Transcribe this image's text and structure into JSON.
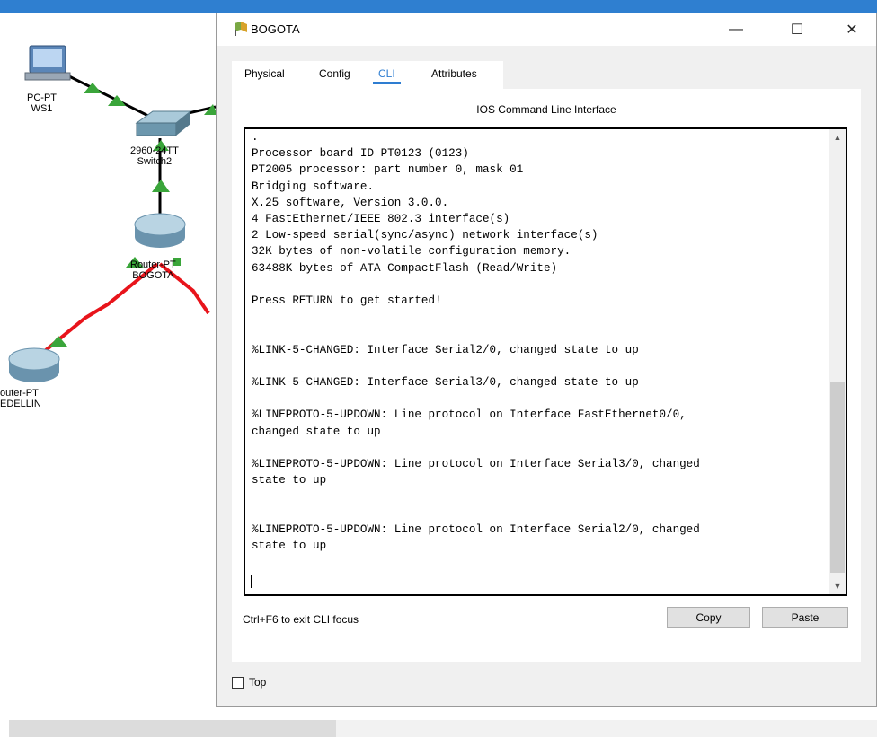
{
  "window": {
    "title": "BOGOTA",
    "minimize_glyph": "—",
    "maximize_glyph": "☐",
    "close_glyph": "✕"
  },
  "tabs": [
    "Physical",
    "Config",
    "CLI",
    "Attributes"
  ],
  "active_tab": "CLI",
  "panel_title": "IOS Command Line Interface",
  "cli_output": ".\nProcessor board ID PT0123 (0123)\nPT2005 processor: part number 0, mask 01\nBridging software.\nX.25 software, Version 3.0.0.\n4 FastEthernet/IEEE 802.3 interface(s)\n2 Low-speed serial(sync/async) network interface(s)\n32K bytes of non-volatile configuration memory.\n63488K bytes of ATA CompactFlash (Read/Write)\n\nPress RETURN to get started!\n\n\n%LINK-5-CHANGED: Interface Serial2/0, changed state to up\n\n%LINK-5-CHANGED: Interface Serial3/0, changed state to up\n\n%LINEPROTO-5-UPDOWN: Line protocol on Interface FastEthernet0/0,\nchanged state to up\n\n%LINEPROTO-5-UPDOWN: Line protocol on Interface Serial3/0, changed\nstate to up\n\n\n%LINEPROTO-5-UPDOWN: Line protocol on Interface Serial2/0, changed\nstate to up",
  "cli_hint": "Ctrl+F6 to exit CLI focus",
  "buttons": {
    "copy": "Copy",
    "paste": "Paste"
  },
  "top_checkbox": {
    "label": "Top",
    "checked": false
  },
  "topology": {
    "devices": [
      {
        "label_line1": "PC-PT",
        "label_line2": "WS1",
        "icon": "pc-icon"
      },
      {
        "label_line1": "2960-24TT",
        "label_line2": "Switch2",
        "icon": "switch-icon"
      },
      {
        "label_line1": "Router-PT",
        "label_line2": "BOGOTA",
        "icon": "router-icon"
      },
      {
        "label_line1": "outer-PT",
        "label_line2": "EDELLIN",
        "icon": "router-icon"
      }
    ],
    "colors": {
      "link_up": "#3aa53a",
      "serial": "#e8141b",
      "ethernet": "#000000"
    }
  }
}
